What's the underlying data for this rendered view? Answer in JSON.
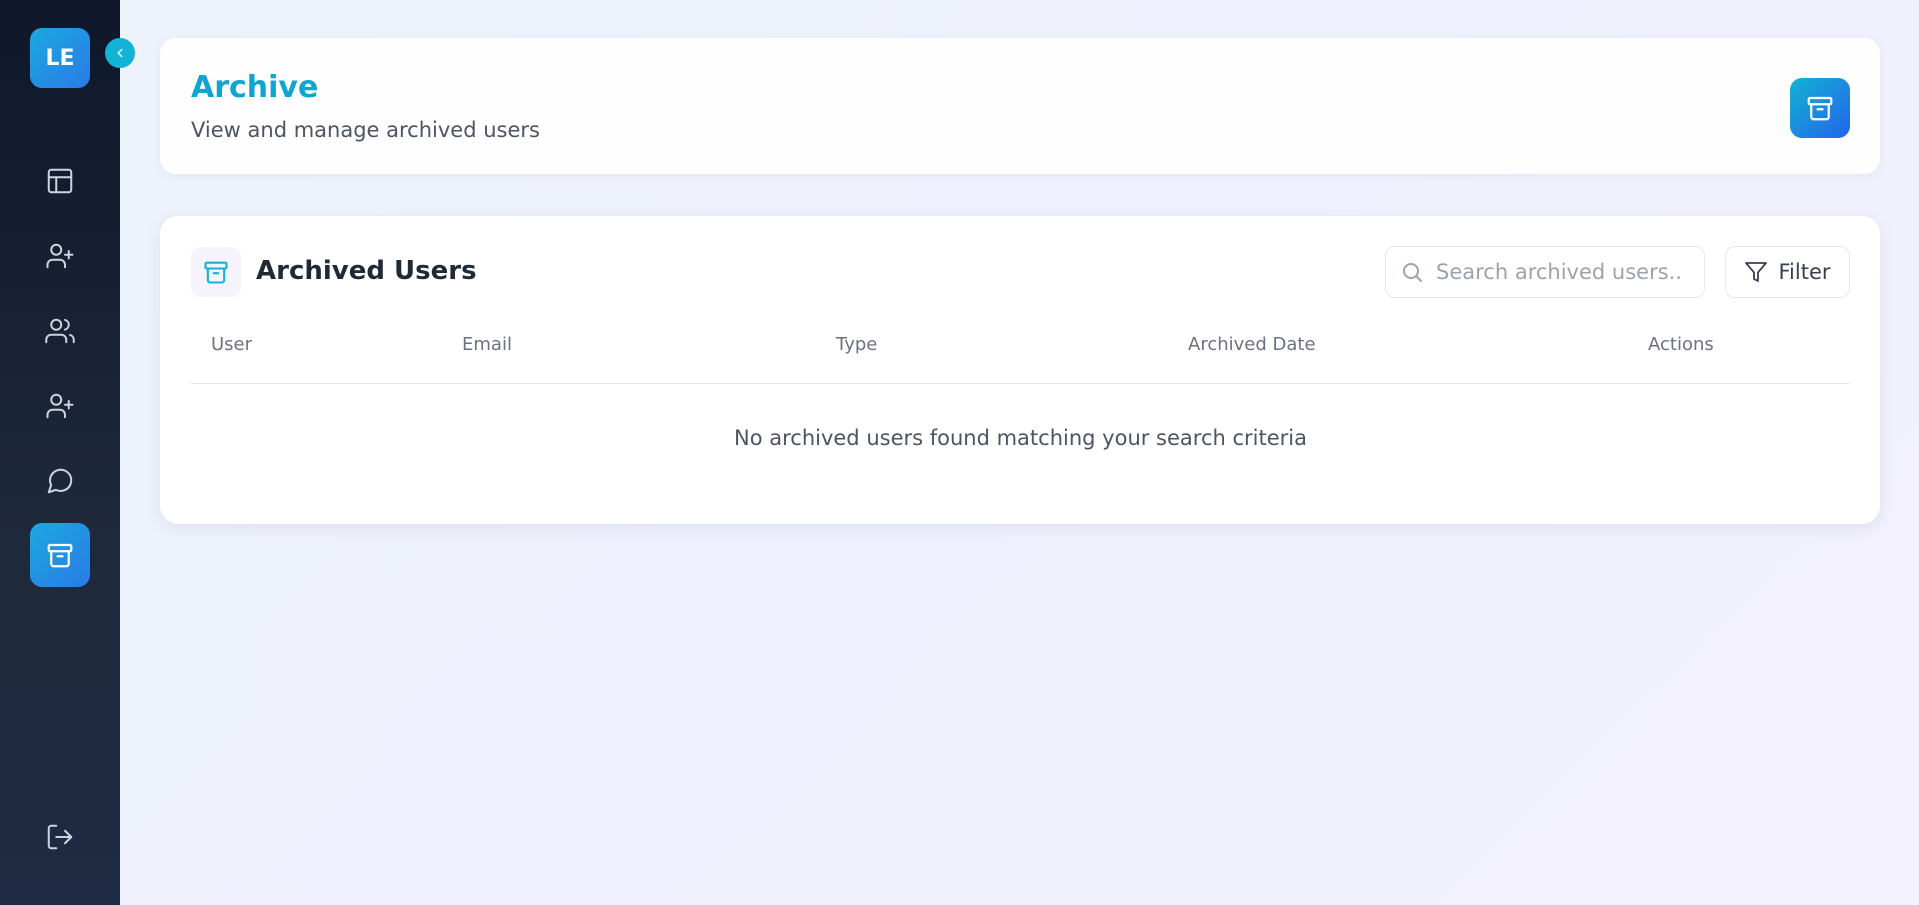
{
  "sidebar": {
    "logo_text": "LE",
    "nav_items": [
      {
        "icon": "layout-icon"
      },
      {
        "icon": "user-plus-icon"
      },
      {
        "icon": "users-icon"
      },
      {
        "icon": "user-plus-icon"
      },
      {
        "icon": "message-circle-icon"
      },
      {
        "icon": "archive-icon",
        "active": true
      }
    ],
    "logout_icon": "log-out-icon"
  },
  "header": {
    "title": "Archive",
    "subtitle": "View and manage archived users"
  },
  "archived_users": {
    "title": "Archived Users",
    "search_placeholder": "Search archived users..",
    "filter_label": "Filter",
    "columns": [
      "User",
      "Email",
      "Type",
      "Archived Date",
      "Actions"
    ],
    "empty_message": "No archived users found matching your search criteria"
  },
  "colors": {
    "accent": "#0ea5d3",
    "sidebar_bg": "#0f172a",
    "gradient_start": "#1ba8df",
    "gradient_end": "#2b7be6"
  }
}
